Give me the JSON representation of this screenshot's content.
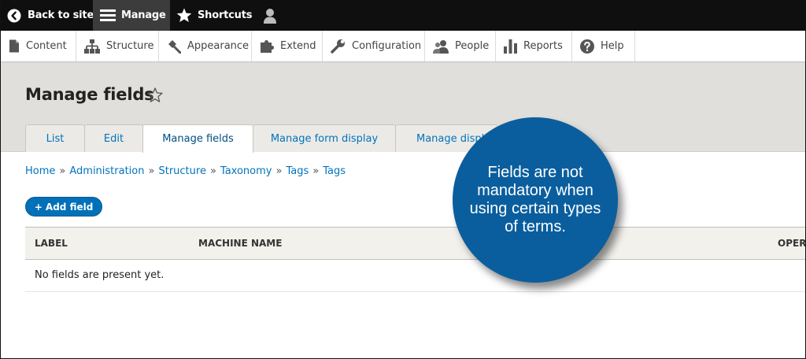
{
  "toolbar": {
    "back_label": "Back to site",
    "manage_label": "Manage",
    "shortcuts_label": "Shortcuts",
    "icons": [
      "chevron-left-circle-icon",
      "hamburger-icon",
      "star-icon",
      "user-icon"
    ]
  },
  "tray": {
    "items": [
      {
        "label": "Content",
        "icon": "file-icon"
      },
      {
        "label": "Structure",
        "icon": "sitemap-icon"
      },
      {
        "label": "Appearance",
        "icon": "paintbrush-icon"
      },
      {
        "label": "Extend",
        "icon": "puzzle-icon"
      },
      {
        "label": "Configuration",
        "icon": "wrench-icon"
      },
      {
        "label": "People",
        "icon": "people-icon"
      },
      {
        "label": "Reports",
        "icon": "bar-chart-icon"
      },
      {
        "label": "Help",
        "icon": "help-icon"
      }
    ]
  },
  "page": {
    "title": "Manage fields",
    "tabs": [
      "List",
      "Edit",
      "Manage fields",
      "Manage form display",
      "Manage displ"
    ],
    "active_tab": "Manage fields"
  },
  "breadcrumb": [
    "Home",
    "Administration",
    "Structure",
    "Taxonomy",
    "Tags",
    "Tags"
  ],
  "actions": {
    "add_field_label": "+ Add field"
  },
  "table": {
    "columns": [
      "LABEL",
      "MACHINE NAME",
      "OPER"
    ],
    "empty_message": "No fields are present yet."
  },
  "callout": {
    "text": "Fields are not mandatory when using certain types of terms."
  },
  "colors": {
    "toolbar_bg": "#0f0f0f",
    "link": "#0074bd",
    "button": "#0071b8",
    "callout": "#0a5e9e",
    "header_bg": "#e0dfdb"
  }
}
